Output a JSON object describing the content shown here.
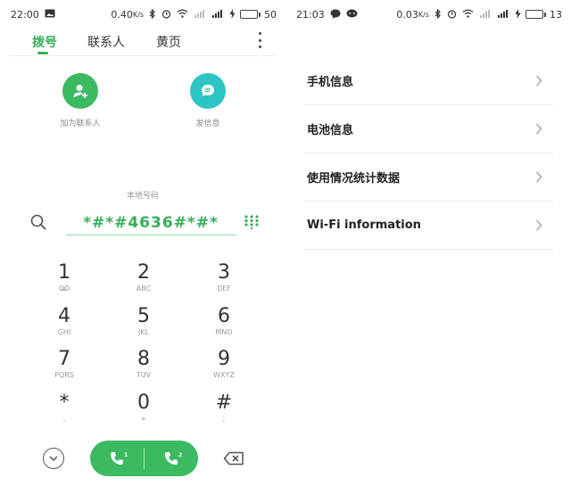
{
  "left": {
    "status": {
      "time": "22:00",
      "speed": "0.40",
      "speed_unit": "K/s",
      "battery_pct": "50",
      "battery_level": 0.5
    },
    "tabs": [
      {
        "label": "拨号",
        "active": true
      },
      {
        "label": "联系人",
        "active": false
      },
      {
        "label": "黄页",
        "active": false
      }
    ],
    "actions": {
      "add_contact": {
        "label": "加为联系人",
        "color": "#3cba62"
      },
      "send_message": {
        "label": "发信息",
        "color": "#2ec4c4"
      }
    },
    "local_number_label": "本地号码",
    "dial_input": "*#*#4636#*#*",
    "keys": [
      {
        "digit": "1",
        "sub": ""
      },
      {
        "digit": "2",
        "sub": "ABC"
      },
      {
        "digit": "3",
        "sub": "DEF"
      },
      {
        "digit": "4",
        "sub": "GHI"
      },
      {
        "digit": "5",
        "sub": "JKL"
      },
      {
        "digit": "6",
        "sub": "MNO"
      },
      {
        "digit": "7",
        "sub": "PQRS"
      },
      {
        "digit": "8",
        "sub": "TUV"
      },
      {
        "digit": "9",
        "sub": "WXYZ"
      },
      {
        "digit": "*",
        "sub": ","
      },
      {
        "digit": "0",
        "sub": "+"
      },
      {
        "digit": "#",
        "sub": ";"
      }
    ],
    "call": {
      "sim1": "1",
      "sim2": "2"
    }
  },
  "right": {
    "status": {
      "time": "21:03",
      "speed": "0.03",
      "speed_unit": "K/s",
      "battery_pct": "13",
      "battery_level": 0.13
    },
    "menu": [
      {
        "label": "手机信息"
      },
      {
        "label": "电池信息"
      },
      {
        "label": "使用情况统计数据"
      },
      {
        "label": "Wi-Fi information"
      }
    ]
  },
  "colors": {
    "accent": "#35b05a",
    "teal": "#2ec4c4"
  }
}
